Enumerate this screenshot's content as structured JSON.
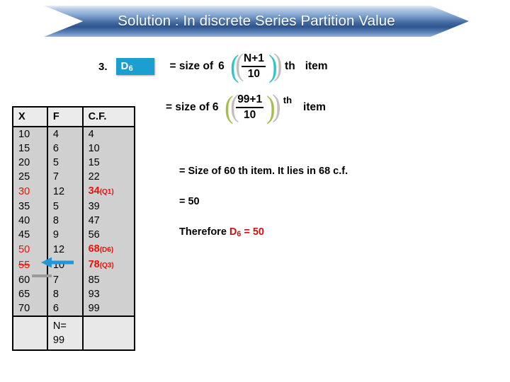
{
  "banner": {
    "title": "Solution : In discrete Series  Partition Value",
    "gradient_start": "#b9cce6",
    "gradient_end": "#2e5590"
  },
  "formula1": {
    "step_number": "3.",
    "badge_label": "D",
    "badge_subscript": "6",
    "badge_color": "#1b9fd1",
    "equals_text": "= size of",
    "multiplier": "6",
    "numerator": "N+1",
    "denominator": "10",
    "ordinal": "th",
    "item": "item",
    "bracket_color": "#2fc5c8"
  },
  "formula2": {
    "equals_text": "= size of 6",
    "numerator": "99+1",
    "denominator": "10",
    "ordinal": "th",
    "item": "item",
    "bracket_color": "#a3bf4a"
  },
  "table": {
    "headers": [
      "X",
      "F",
      "C.F."
    ],
    "rows": [
      {
        "x": "10",
        "f": "4",
        "cf": "4",
        "x_hl": false,
        "cf_hl": false,
        "cf_tag": ""
      },
      {
        "x": "15",
        "f": "6",
        "cf": "10",
        "x_hl": false,
        "cf_hl": false,
        "cf_tag": ""
      },
      {
        "x": "20",
        "f": "5",
        "cf": "15",
        "x_hl": false,
        "cf_hl": false,
        "cf_tag": ""
      },
      {
        "x": "25",
        "f": "7",
        "cf": "22",
        "x_hl": false,
        "cf_hl": false,
        "cf_tag": ""
      },
      {
        "x": "30",
        "f": "12",
        "cf": "34",
        "x_hl": true,
        "cf_hl": true,
        "cf_tag": "(Q1)"
      },
      {
        "x": "35",
        "f": "5",
        "cf": "39",
        "x_hl": false,
        "cf_hl": false,
        "cf_tag": ""
      },
      {
        "x": "40",
        "f": "8",
        "cf": "47",
        "x_hl": false,
        "cf_hl": false,
        "cf_tag": ""
      },
      {
        "x": "45",
        "f": "9",
        "cf": "56",
        "x_hl": false,
        "cf_hl": false,
        "cf_tag": ""
      },
      {
        "x": "50",
        "f": "12",
        "cf": "68",
        "x_hl": true,
        "cf_hl": true,
        "cf_tag": "(D6)"
      },
      {
        "x": "55",
        "f": "10",
        "cf": "78",
        "x_hl": true,
        "cf_hl": true,
        "cf_tag": "(Q3)"
      },
      {
        "x": "60",
        "f": "7",
        "cf": "85",
        "x_hl": false,
        "cf_hl": false,
        "cf_tag": ""
      },
      {
        "x": "65",
        "f": "8",
        "cf": "93",
        "x_hl": false,
        "cf_hl": false,
        "cf_tag": ""
      },
      {
        "x": "70",
        "f": "6",
        "cf": "99",
        "x_hl": false,
        "cf_hl": false,
        "cf_tag": ""
      }
    ],
    "footer": {
      "x": "",
      "f_line1": "N=",
      "f_line2": "99",
      "cf": ""
    },
    "highlight_color": "#e8120b"
  },
  "annotations": {
    "arrow_color": "#2196d8",
    "arrow_target_row": "50",
    "strike_row": "55"
  },
  "notes": {
    "note1": "= Size of 60 th item. It lies in 68 c.f.",
    "note2": "= 50",
    "note3_prefix": "Therefore ",
    "note3_symbol": "D",
    "note3_subscript": "6",
    "note3_value": " = 50",
    "note3_color": "#cc1111"
  }
}
